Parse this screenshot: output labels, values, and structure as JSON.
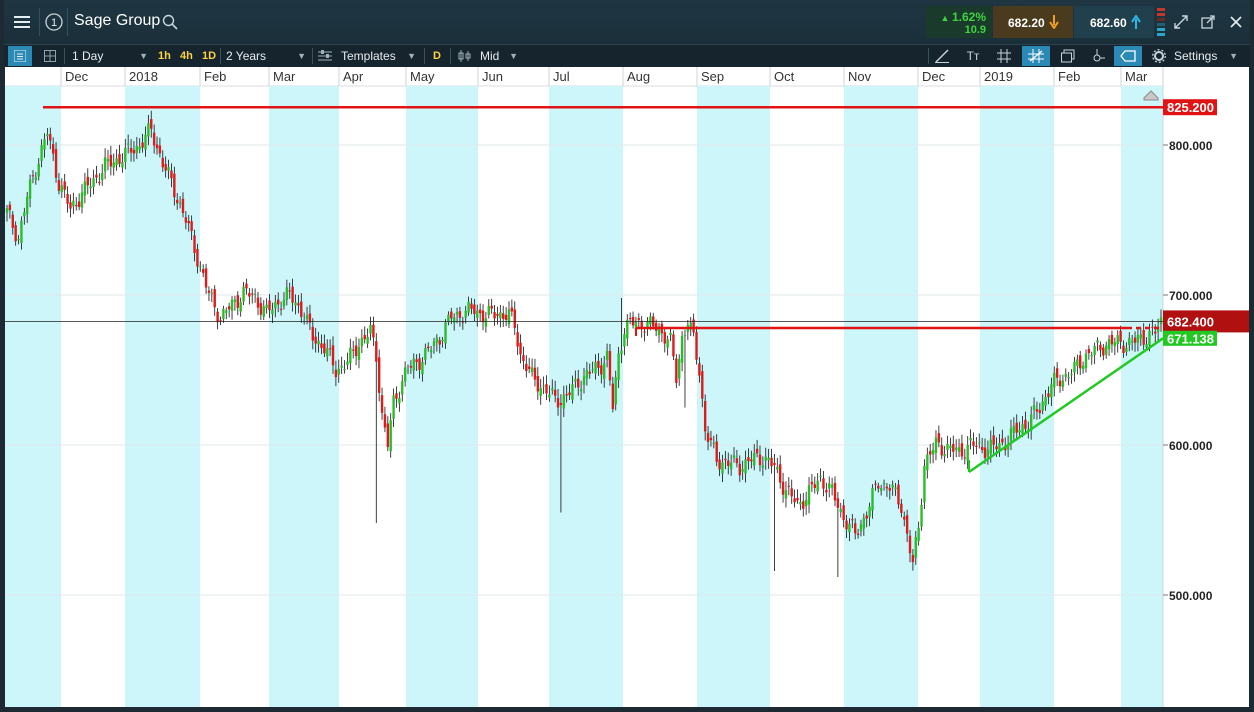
{
  "header": {
    "title": "Sage Group",
    "notification_count": "1",
    "change_pct": "1.62%",
    "change_abs": "10.9",
    "sell_price": "682.20",
    "buy_price": "682.60"
  },
  "toolbar": {
    "interval": "1 Day",
    "quick_intervals": [
      "1h",
      "4h",
      "1D"
    ],
    "range": "2 Years",
    "templates_label": "Templates",
    "d_label": "D",
    "price_type": "Mid",
    "settings_label": "Settings"
  },
  "icons": [
    "menu-icon",
    "notification-icon",
    "search-icon",
    "arrow-down-icon",
    "arrow-up-icon",
    "list-view-icon",
    "grid-layout-icon",
    "templates-icon",
    "bars-icon",
    "draw-line-icon",
    "text-size-icon",
    "crosshair-icon",
    "grid-icon",
    "copy-icon",
    "indicator-icon",
    "shape-icon",
    "gear-icon",
    "expand-icon",
    "popout-icon",
    "close-icon"
  ],
  "colors": {
    "up": "#2dbb2d",
    "down": "#d91c1c",
    "support": "#22c922",
    "resistance": "#e01414",
    "band": "#ccf6f9"
  },
  "chart_data": {
    "type": "candlestick",
    "title": "Sage Group",
    "x_labels": [
      "Dec",
      "2018",
      "Feb",
      "Mar",
      "Apr",
      "May",
      "Jun",
      "Jul",
      "Aug",
      "Sep",
      "Oct",
      "Nov",
      "Dec",
      "2019",
      "Feb",
      "Mar"
    ],
    "y_ticks": [
      500,
      600,
      700,
      800
    ],
    "y_tick_labels": [
      "500.000",
      "600.000",
      "700.000",
      "800.000"
    ],
    "ylim": [
      485,
      830
    ],
    "last_price": 682.4,
    "last_price_label": "682.400",
    "levels": [
      {
        "name": "resistance-high",
        "value": 825.2,
        "label": "825.200",
        "color": "#e01414"
      },
      {
        "name": "resistance-mid",
        "value": 678.0,
        "label": "",
        "color": "#e01414"
      },
      {
        "name": "support-trendline",
        "value": 671.138,
        "label": "671.138",
        "color": "#22c922"
      }
    ],
    "path": [
      [
        0,
        755
      ],
      [
        4,
        738
      ],
      [
        7,
        765
      ],
      [
        10,
        785
      ],
      [
        14,
        808
      ],
      [
        18,
        775
      ],
      [
        22,
        757
      ],
      [
        26,
        768
      ],
      [
        30,
        776
      ],
      [
        34,
        786
      ],
      [
        38,
        790
      ],
      [
        42,
        795
      ],
      [
        46,
        800
      ],
      [
        50,
        810
      ],
      [
        54,
        788
      ],
      [
        58,
        770
      ],
      [
        62,
        750
      ],
      [
        66,
        725
      ],
      [
        70,
        700
      ],
      [
        74,
        685
      ],
      [
        78,
        693
      ],
      [
        82,
        702
      ],
      [
        86,
        698
      ],
      [
        90,
        688
      ],
      [
        94,
        695
      ],
      [
        98,
        700
      ],
      [
        102,
        690
      ],
      [
        106,
        672
      ],
      [
        110,
        665
      ],
      [
        114,
        650
      ],
      [
        118,
        655
      ],
      [
        122,
        668
      ],
      [
        126,
        675
      ],
      [
        128,
        660
      ],
      [
        130,
        620
      ],
      [
        132,
        600
      ],
      [
        134,
        628
      ],
      [
        138,
        648
      ],
      [
        142,
        655
      ],
      [
        146,
        662
      ],
      [
        150,
        672
      ],
      [
        154,
        685
      ],
      [
        158,
        688
      ],
      [
        162,
        690
      ],
      [
        166,
        686
      ],
      [
        170,
        688
      ],
      [
        174,
        686
      ],
      [
        176,
        680
      ],
      [
        178,
        660
      ],
      [
        182,
        645
      ],
      [
        186,
        638
      ],
      [
        190,
        630
      ],
      [
        194,
        632
      ],
      [
        198,
        642
      ],
      [
        202,
        648
      ],
      [
        206,
        654
      ],
      [
        208,
        658
      ],
      [
        210,
        625
      ],
      [
        212,
        660
      ],
      [
        214,
        678
      ],
      [
        218,
        682
      ],
      [
        222,
        680
      ],
      [
        226,
        678
      ],
      [
        230,
        668
      ],
      [
        232,
        645
      ],
      [
        234,
        672
      ],
      [
        236,
        682
      ],
      [
        238,
        670
      ],
      [
        240,
        650
      ],
      [
        242,
        610
      ],
      [
        246,
        590
      ],
      [
        250,
        588
      ],
      [
        254,
        586
      ],
      [
        258,
        590
      ],
      [
        262,
        592
      ],
      [
        266,
        585
      ],
      [
        270,
        570
      ],
      [
        274,
        560
      ],
      [
        278,
        568
      ],
      [
        282,
        578
      ],
      [
        286,
        568
      ],
      [
        290,
        552
      ],
      [
        294,
        540
      ],
      [
        298,
        555
      ],
      [
        302,
        575
      ],
      [
        306,
        572
      ],
      [
        310,
        560
      ],
      [
        314,
        520
      ],
      [
        316,
        545
      ],
      [
        318,
        588
      ],
      [
        322,
        600
      ],
      [
        326,
        598
      ],
      [
        330,
        595
      ],
      [
        334,
        600
      ],
      [
        338,
        598
      ],
      [
        342,
        598
      ],
      [
        346,
        602
      ],
      [
        350,
        610
      ],
      [
        354,
        615
      ],
      [
        358,
        625
      ],
      [
        362,
        640
      ],
      [
        366,
        645
      ],
      [
        370,
        650
      ],
      [
        374,
        660
      ],
      [
        378,
        664
      ],
      [
        382,
        668
      ],
      [
        386,
        668
      ],
      [
        390,
        668
      ],
      [
        394,
        672
      ],
      [
        398,
        675
      ],
      [
        400,
        682
      ]
    ]
  }
}
